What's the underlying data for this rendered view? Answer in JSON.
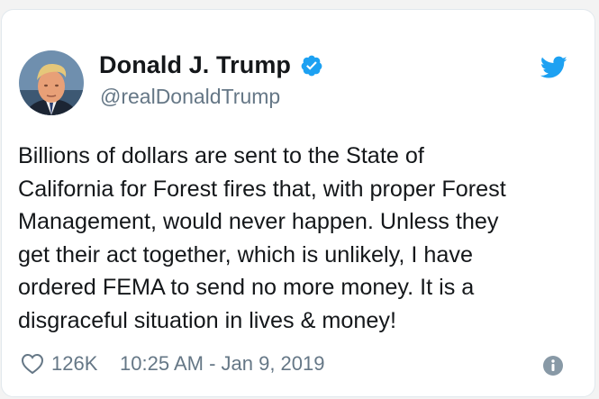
{
  "tweet": {
    "display_name": "Donald J. Trump",
    "handle": "@realDonaldTrump",
    "verified": true,
    "text": "Billions of dollars are sent to the State of\nCalifornia for Forest fires that, with proper Forest\nManagement, would never happen. Unless they\nget their act together, which is unlikely, I have\nordered FEMA to send no more money. It is a\ndisgraceful situation in lives & money!",
    "likes": "126K",
    "timestamp": "10:25 AM - Jan 9, 2019"
  },
  "icons": {
    "verified": "verified-badge-icon",
    "brand": "twitter-bird-icon",
    "like": "heart-icon",
    "info": "info-icon"
  },
  "colors": {
    "brand_blue": "#1da1f2",
    "text_primary": "#14171a",
    "text_secondary": "#657786",
    "border": "#e1e8ed"
  }
}
